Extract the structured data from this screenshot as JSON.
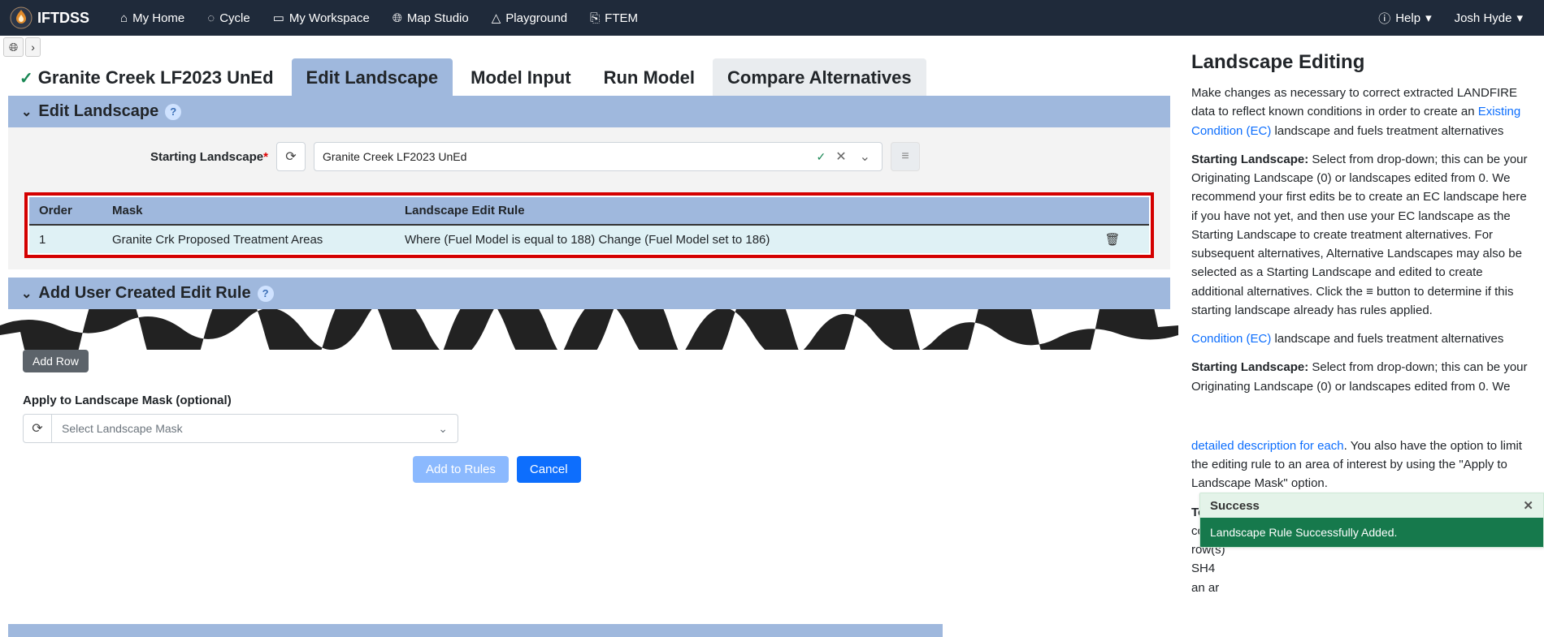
{
  "navbar": {
    "brand": "IFTDSS",
    "items": [
      "My Home",
      "Cycle",
      "My Workspace",
      "Map Studio",
      "Playground",
      "FTEM"
    ],
    "help": "Help",
    "user": "Josh Hyde"
  },
  "tabs": {
    "title": "Granite Creek LF2023 UnEd",
    "items": [
      "Edit Landscape",
      "Model Input",
      "Run Model",
      "Compare Alternatives"
    ],
    "active": 0
  },
  "section1": {
    "title": "Edit Landscape"
  },
  "form": {
    "starting_label": "Starting Landscape",
    "starting_value": "Granite Creek LF2023 UnEd"
  },
  "rules": {
    "headers": [
      "Order",
      "Mask",
      "Landscape Edit Rule",
      ""
    ],
    "rows": [
      {
        "order": "1",
        "mask": "Granite Crk Proposed Treatment Areas",
        "rule": "Where (Fuel Model is equal to 188) Change (Fuel Model set to 186)"
      }
    ]
  },
  "section2": {
    "title": "Add User Created Edit Rule"
  },
  "lower": {
    "addrow": "Add Row",
    "mask_label": "Apply to Landscape Mask (optional)",
    "mask_placeholder": "Select Landscape Mask",
    "add_rules": "Add to Rules",
    "cancel": "Cancel"
  },
  "help": {
    "title": "Landscape Editing",
    "p1a": "Make changes as necessary to correct extracted LANDFIRE data to reflect known conditions in order to create an ",
    "p1link": "Existing Condition (EC)",
    "p1b": " landscape and fuels treatment alternatives",
    "sl": "Starting Landscape:",
    "p2": " Select from drop-down; this can be your Originating Landscape (0) or landscapes edited from 0. We recommend your first edits be to create an EC landscape here if you have not yet, and then use your EC landscape as the Starting Landscape to create treatment alternatives. For subsequent alternatives, Alternative Landscapes may also be selected as a Starting Landscape and edited to create additional alternatives. Click the ≡ button to determine if this starting landscape already has rules applied.",
    "p3link": "Condition (EC)",
    "p3b": " landscape and fuels treatment alternatives",
    "p4": " Select from drop-down; this can be your Originating Landscape (0) or landscapes edited from 0. We",
    "p5link": "detailed description for each",
    "p5b": ". You also have the option to limit the editing rule to an area of interest by using the \"Apply to Landscape Mask\" option.",
    "p6h": "To Add User Created Edit Rules:",
    "p6": " Add row(s) to identify condition where you want to make a change and then add row(s) ",
    "p6b": "SH4 ",
    "p6c": "an ar"
  },
  "toast": {
    "head": "Success",
    "body": "Landscape Rule Successfully Added."
  }
}
